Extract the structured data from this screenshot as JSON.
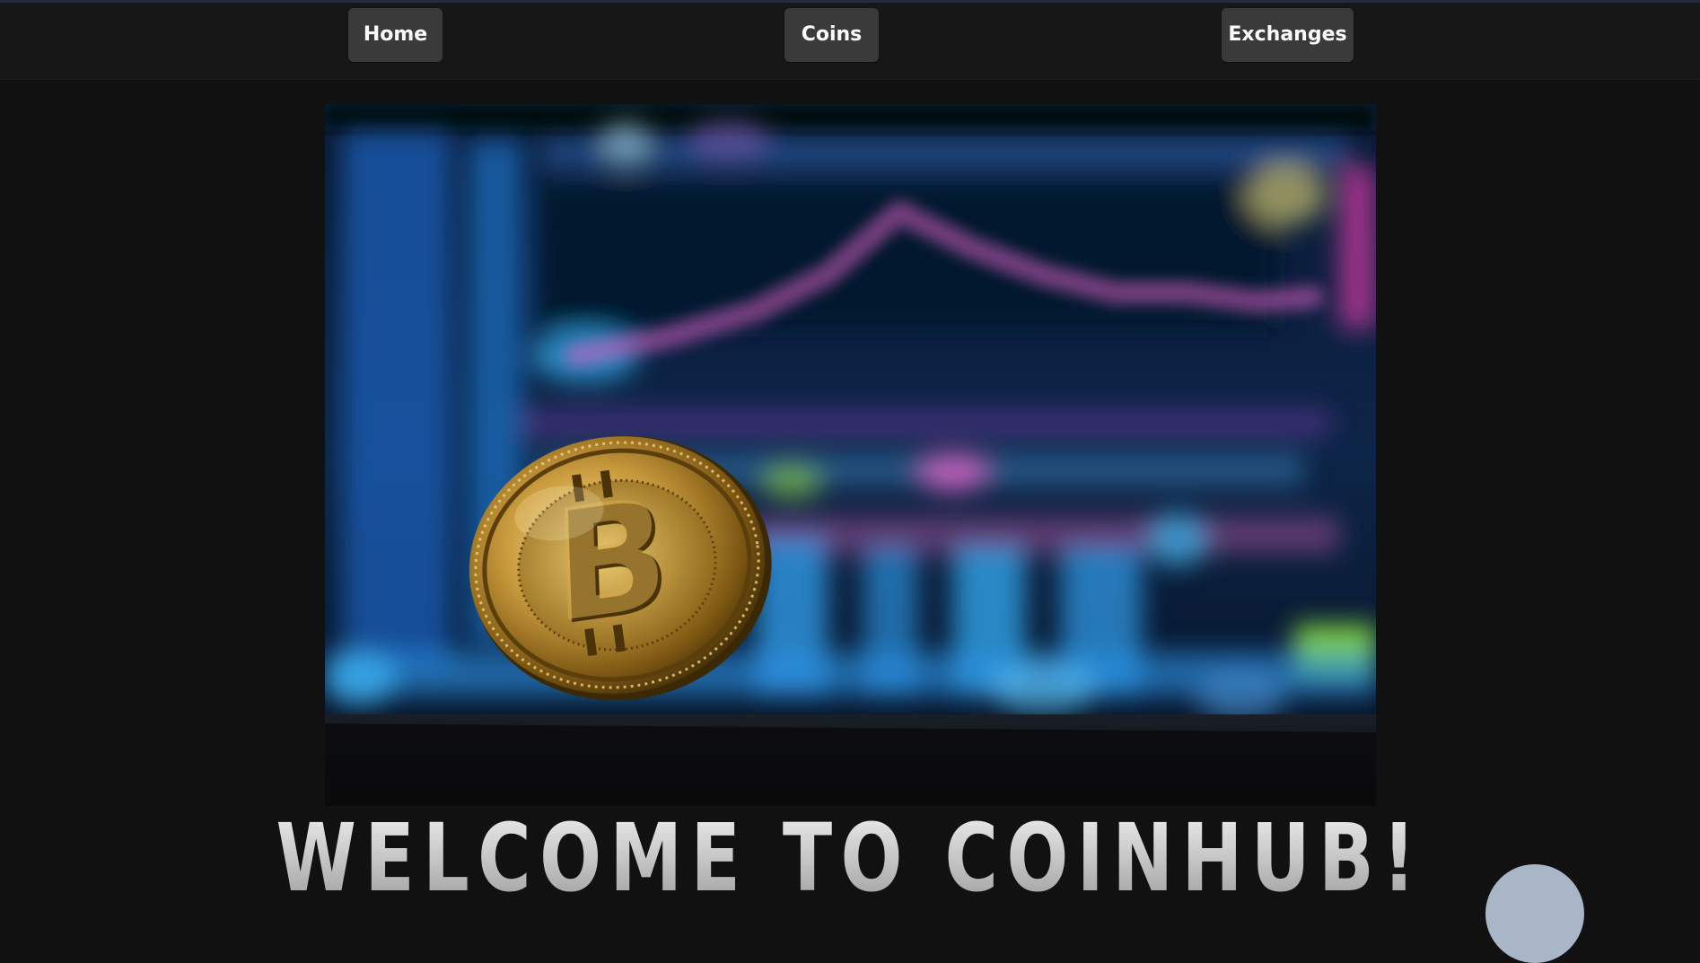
{
  "nav": {
    "home_label": "Home",
    "coins_label": "Coins",
    "exchanges_label": "Exchanges"
  },
  "hero": {
    "image": "bitcoin-coin-photo",
    "heading": "WELCOME TO COINHUB!"
  },
  "colors": {
    "page_bg": "#111111",
    "navbar_bg": "#171717",
    "nav_button_bg": "#3a3a3a",
    "nav_button_text": "#ffffff",
    "heading_text": "#d6d6d6",
    "fab_bg": "#a9b6c8"
  }
}
